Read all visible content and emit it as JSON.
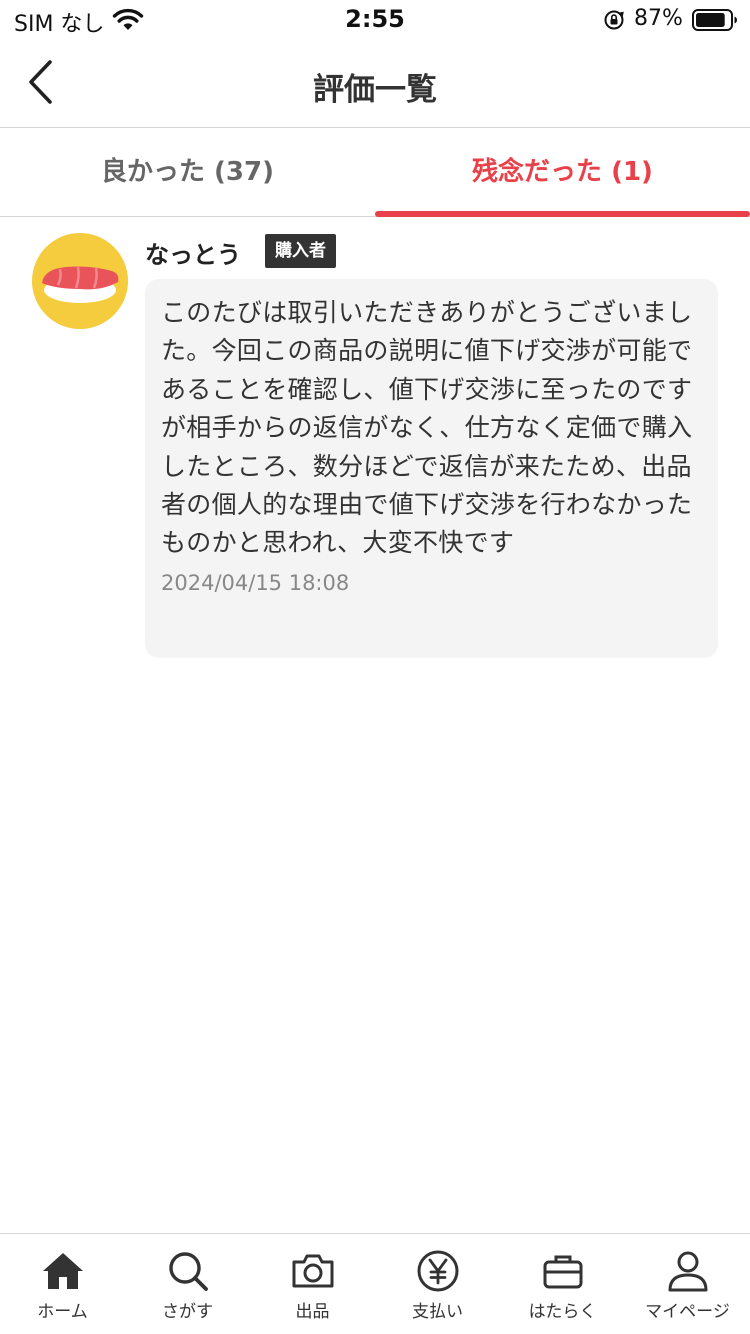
{
  "status_bar": {
    "carrier": "SIM なし",
    "time": "2:55",
    "battery_percent": "87%",
    "battery_level": 0.87
  },
  "nav": {
    "title": "評価一覧",
    "back_icon": "chevron-left-icon"
  },
  "tabs": [
    {
      "label": "良かった (37)",
      "selected": false
    },
    {
      "label": "残念だった (1)",
      "selected": true
    }
  ],
  "accent_color": "#e8414a",
  "review": {
    "reviewer_name": "なっとう",
    "role_badge": "購入者",
    "avatar_icon": "sushi-icon",
    "comment": "このたびは取引いただきありがとうございました。今回この商品の説明に値下げ交渉が可能であることを確認し、値下げ交渉に至ったのですが相手からの返信がなく、仕方なく定価で購入したところ、数分ほどで返信が来たため、出品者の個人的な理由で値下げ交渉を行わなかったものかと思われ、大変不快です",
    "date": "2024/04/15 18:08"
  },
  "bottom_nav": [
    {
      "label": "ホーム",
      "icon": "home-icon"
    },
    {
      "label": "さがす",
      "icon": "search-icon"
    },
    {
      "label": "出品",
      "icon": "camera-icon"
    },
    {
      "label": "支払い",
      "icon": "yen-icon"
    },
    {
      "label": "はたらく",
      "icon": "briefcase-icon"
    },
    {
      "label": "マイページ",
      "icon": "person-icon"
    }
  ]
}
